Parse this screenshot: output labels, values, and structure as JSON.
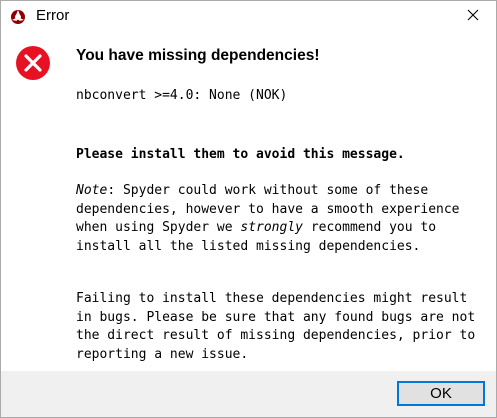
{
  "window": {
    "title": "Error",
    "app_icon": "spyder-icon",
    "close_icon": "close-icon"
  },
  "message": {
    "icon": "error-icon",
    "headline": "You have missing dependencies!",
    "missing_line": "nbconvert >=4.0: None (NOK)",
    "install_line": "Please install them to avoid this message.",
    "note_label": "Note",
    "note_text_1": ": Spyder could work without some of these dependencies, however to have a smooth experience when using Spyder we ",
    "note_emphasis": "strongly",
    "note_text_2": " recommend you to install all the listed missing dependencies.",
    "failing_para": "Failing to install these dependencies might result in bugs. Please be sure that any found bugs are not the direct result of missing dependencies, prior to reporting a new issue."
  },
  "footer": {
    "ok_label": "OK"
  },
  "colors": {
    "error_red": "#e81123",
    "focus_blue": "#0078d7",
    "footer_bg": "#f0f0f0"
  }
}
